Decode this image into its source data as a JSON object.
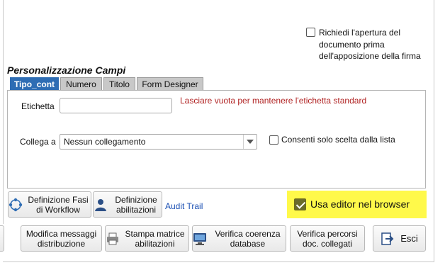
{
  "signature": {
    "require_open_label": "Richiedi l'apertura del documento prima dell'apposizione della firma"
  },
  "section": {
    "title": "Personalizzazione Campi"
  },
  "tabs": [
    {
      "label": "Tipo_cont",
      "active": true
    },
    {
      "label": "Numero",
      "active": false
    },
    {
      "label": "Titolo",
      "active": false
    },
    {
      "label": "Form Designer",
      "active": false
    }
  ],
  "form": {
    "label_field": {
      "label": "Etichetta",
      "value": "",
      "hint": "Lasciare vuota per mantenere l'etichetta standard"
    },
    "link_field": {
      "label": "Collega a",
      "selected": "Nessun collegamento"
    },
    "list_only": {
      "label": "Consenti solo scelta dalla lista",
      "checked": false
    }
  },
  "actions_row1": {
    "workflow_btn": "Definizione Fasi di Workflow",
    "perms_btn": "Definizione abilitazioni",
    "audit_link": "Audit Trail"
  },
  "editor": {
    "label": "Usa editor nel browser",
    "checked": true,
    "highlight": "#fff94a"
  },
  "actions_row2": {
    "messages_btn": "Modifica messaggi distribuzione",
    "print_btn": "Stampa matrice abilitazioni",
    "db_btn": "Verifica coerenza database",
    "paths_btn": "Verifica percorsi doc. collegati",
    "exit_btn": "Esci"
  },
  "colors": {
    "active_tab": "#2e6db4",
    "hint": "#b02222",
    "link": "#1a4fb3"
  }
}
